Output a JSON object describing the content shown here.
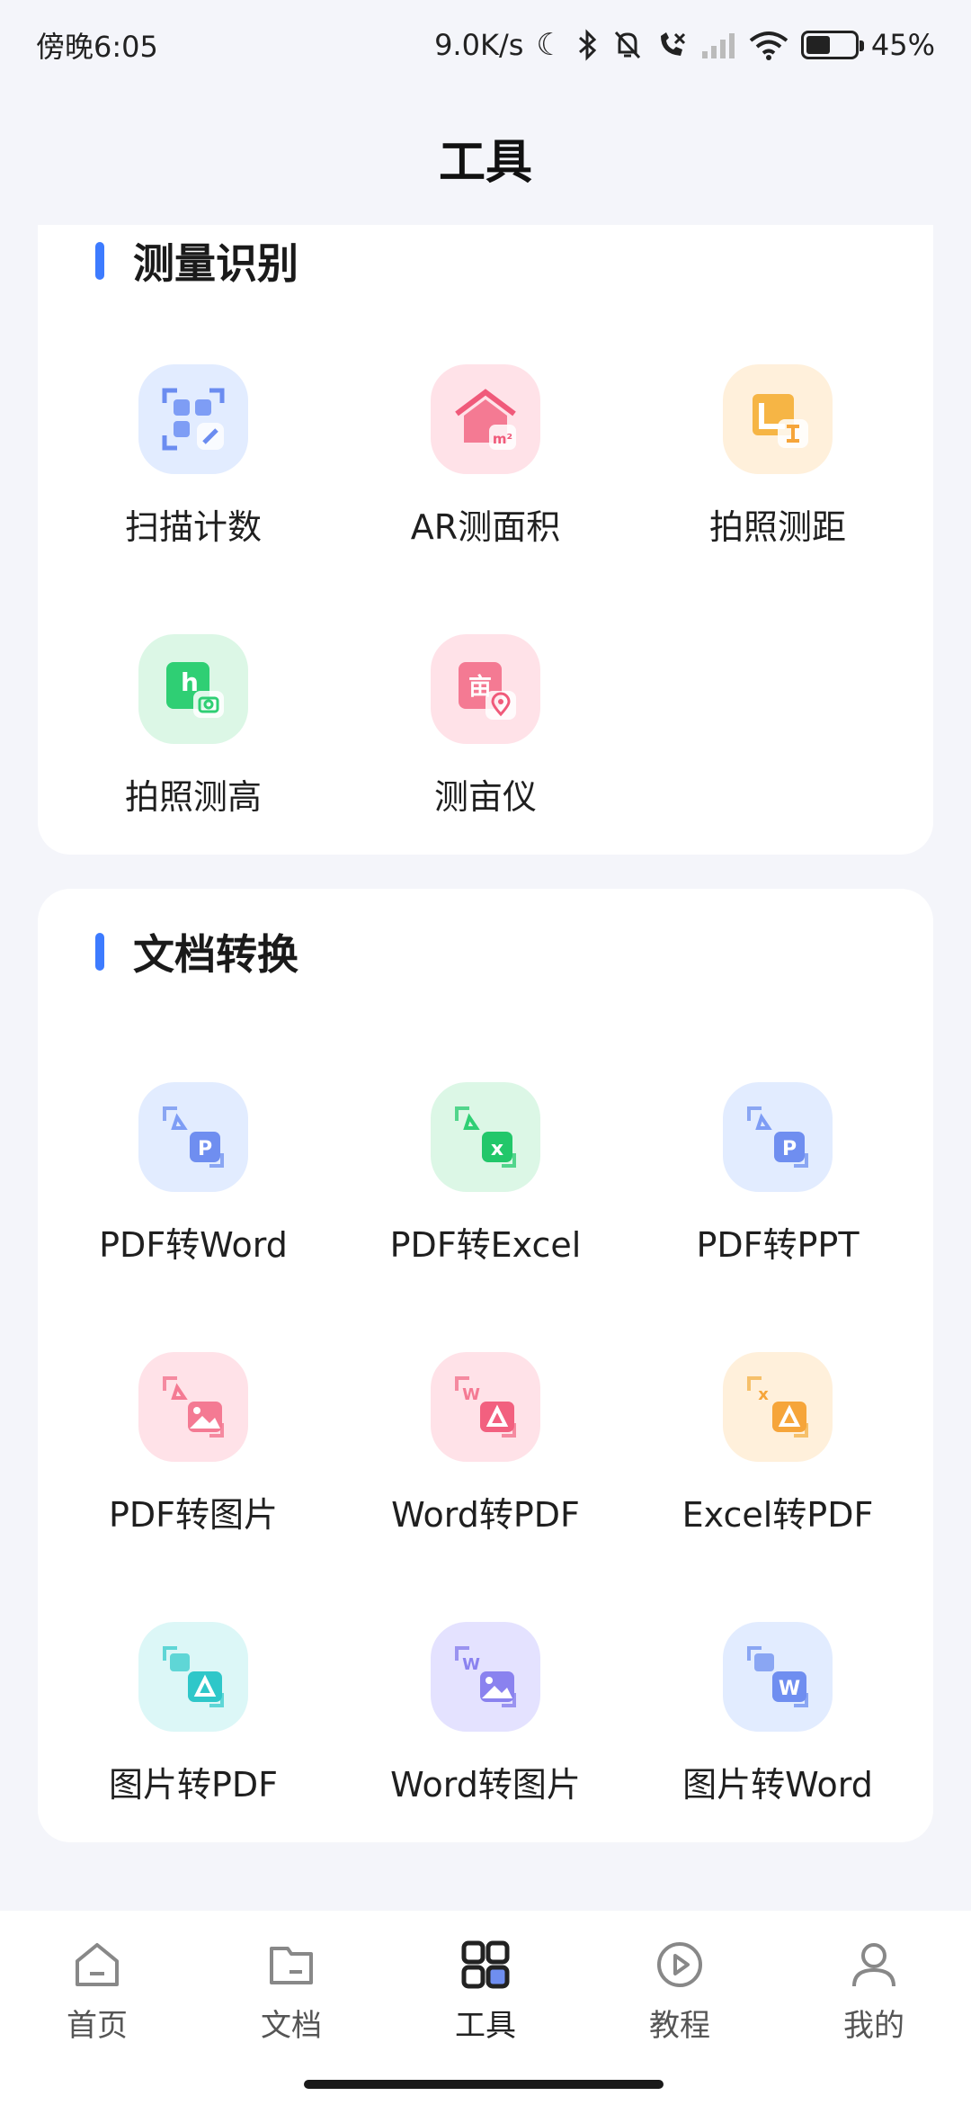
{
  "status_bar": {
    "time": "傍晚6:05",
    "network_speed": "9.0K/s",
    "battery_percent": "45%",
    "battery_level": 0.45
  },
  "header": {
    "title": "工具"
  },
  "sections": {
    "measure": {
      "title": "测量识别",
      "tools": [
        {
          "label": "扫描计数",
          "icon": "scan-count-icon"
        },
        {
          "label": "AR测面积",
          "icon": "ar-area-icon"
        },
        {
          "label": "拍照测距",
          "icon": "photo-distance-icon"
        },
        {
          "label": "拍照测高",
          "icon": "photo-height-icon"
        },
        {
          "label": "测亩仪",
          "icon": "acre-meter-icon"
        }
      ]
    },
    "convert": {
      "title": "文档转换",
      "tools": [
        {
          "label": "PDF转Word",
          "icon": "pdf-to-word-icon"
        },
        {
          "label": "PDF转Excel",
          "icon": "pdf-to-excel-icon"
        },
        {
          "label": "PDF转PPT",
          "icon": "pdf-to-ppt-icon"
        },
        {
          "label": "PDF转图片",
          "icon": "pdf-to-image-icon"
        },
        {
          "label": "Word转PDF",
          "icon": "word-to-pdf-icon"
        },
        {
          "label": "Excel转PDF",
          "icon": "excel-to-pdf-icon"
        },
        {
          "label": "图片转PDF",
          "icon": "image-to-pdf-icon"
        },
        {
          "label": "Word转图片",
          "icon": "word-to-image-icon"
        },
        {
          "label": "图片转Word",
          "icon": "image-to-word-icon"
        }
      ]
    }
  },
  "glyphs": {
    "area_unit": "m²",
    "acre": "亩",
    "height": "h",
    "excel": "x",
    "word": "W",
    "ppt": "P"
  },
  "bottom_nav": [
    {
      "label": "首页",
      "icon": "home-icon",
      "active": false
    },
    {
      "label": "文档",
      "icon": "folder-icon",
      "active": false
    },
    {
      "label": "工具",
      "icon": "grid-tools-icon",
      "active": true
    },
    {
      "label": "教程",
      "icon": "play-circle-icon",
      "active": false
    },
    {
      "label": "我的",
      "icon": "user-icon",
      "active": false
    }
  ],
  "colors": {
    "accent": "#3d7bff",
    "background": "#f4f5fa",
    "card": "#ffffff"
  }
}
